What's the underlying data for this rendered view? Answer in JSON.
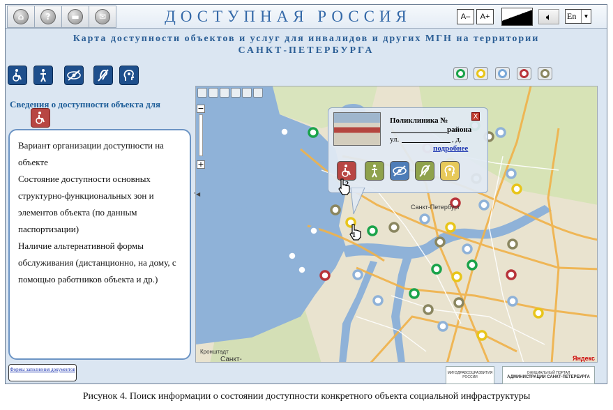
{
  "header": {
    "title": "ДОСТУПНАЯ РОССИЯ",
    "font_smaller": "А–",
    "font_larger": "А+",
    "language": "En",
    "icons": [
      "home-icon",
      "help-icon",
      "print-icon",
      "mail-icon",
      "contrast-icon",
      "sound-icon"
    ]
  },
  "subtitle": {
    "line1": "Карта доступности объектов и услуг для инвалидов и других МГН на территории",
    "line2": "САНКТ-ПЕТЕРБУРГА"
  },
  "categories": [
    "wheelchair",
    "musculoskeletal",
    "vision",
    "hearing",
    "mental"
  ],
  "legend_colors": [
    "#1aa34a",
    "#e8c51a",
    "#7aa8d8",
    "#b8343a",
    "#8a8660"
  ],
  "info": {
    "heading": "Сведения о доступности объекта для",
    "items": [
      "Вариант организации доступности на объекте",
      "Состояние доступности основных структурно-функциональных зон  и элементов объекта (по данным паспортизации)",
      "Наличие альтернативной формы обслуживания (дистанционно, на дому, с помощью работников объекта и др.)"
    ],
    "form_link": "Формы заполнения документов"
  },
  "popup": {
    "title": "Поликлиника №",
    "district": "района",
    "street_label": "ул.",
    "house_label": ", д.",
    "more_link": "подробнее",
    "close": "X"
  },
  "map": {
    "labels": {
      "city": "Санкт-Петербург",
      "kronstadt": "Кронштадт",
      "bottom_city": "Санкт-",
      "provider": "Яндекс"
    },
    "markers": {
      "cursor1": "1",
      "cursor2": "2"
    }
  },
  "footer": {
    "logo1": "МИНЗДРАВСОЦРАЗВИТИЯ РОССИИ",
    "logo2_top": "ОФИЦИАЛЬНЫЙ ПОРТАЛ",
    "logo2": "АДМИНИСТРАЦИИ САНКТ-ПЕТЕРБУРГА"
  },
  "caption": "Рисунок 4. Поиск информации о состоянии доступности конкретного объекта социальной инфраструктуры"
}
